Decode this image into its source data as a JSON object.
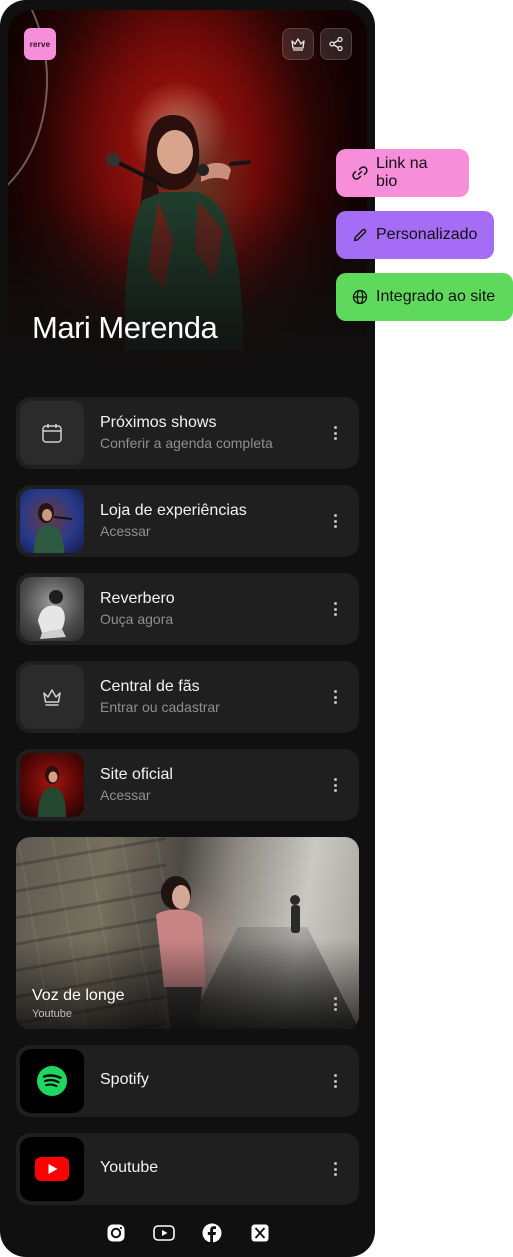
{
  "app": {
    "logo_text": "rerve",
    "artist_name": "Mari Merenda"
  },
  "links": [
    {
      "title": "Próximos shows",
      "subtitle": "Conferir a agenda completa",
      "icon": "calendar-icon"
    },
    {
      "title": "Loja de experiências",
      "subtitle": "Acessar",
      "icon": "concert-photo"
    },
    {
      "title": "Reverbero",
      "subtitle": "Ouça agora",
      "icon": "album-cover"
    },
    {
      "title": "Central de fãs",
      "subtitle": "Entrar ou cadastrar",
      "icon": "crown-icon"
    },
    {
      "title": "Site oficial",
      "subtitle": "Acessar",
      "icon": "stage-photo"
    }
  ],
  "video": {
    "title": "Voz de longe",
    "source": "Youtube"
  },
  "platforms": [
    {
      "title": "Spotify",
      "icon": "spotify-icon",
      "color": "#1ed760"
    },
    {
      "title": "Youtube",
      "icon": "youtube-icon",
      "color": "#ff0000"
    }
  ],
  "socials": [
    "instagram-icon",
    "youtube-icon",
    "facebook-icon",
    "x-icon"
  ],
  "features": [
    {
      "label": "Link na bio",
      "icon": "link-icon",
      "color": "#f78ed9"
    },
    {
      "label": "Personalizado",
      "icon": "pencil-icon",
      "color": "#a56cf5"
    },
    {
      "label": "Integrado ao site",
      "icon": "globe-icon",
      "color": "#5fd95c"
    }
  ]
}
